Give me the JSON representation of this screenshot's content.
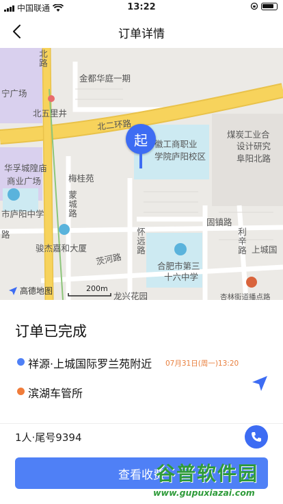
{
  "status_bar": {
    "carrier": "中国联通",
    "time": "13:22"
  },
  "nav": {
    "title": "订单详情"
  },
  "map": {
    "labels": {
      "jindu": "金都华庭一期",
      "ning_square": "宁广场",
      "north_road_v": "北路",
      "bei5lijing": "北五里井",
      "bei2huan": "北二环路",
      "coal": "煤炭工业合",
      "design": "设计研究",
      "fuyang_north": "阜阳北路",
      "hua": "华孚城隍庙",
      "commerce": "商业广场",
      "meigui": "梅桂苑",
      "meng_cheng": "蒙城路",
      "school": "市庐阳中学",
      "gu_zhen": "固镇路",
      "li_xin": "利辛路",
      "jun": "骏杰嘉和大厦",
      "chahe": "茨河路",
      "heliu": "合肥市第三",
      "no36": "十六中学",
      "shangcheng": "上城国",
      "huai_yuan": "怀远路",
      "long_xing": "龙兴花园",
      "xinglin": "杏林街道播点路",
      "vocational_1": "徽工商职业",
      "vocational_2": "学院庐阳校区",
      "road_lu": "路",
      "scale": "200m",
      "logo": "高德地图",
      "start_marker": "起"
    }
  },
  "order": {
    "status": "订单已完成",
    "pickup": "祥源·上城国际罗兰苑附近",
    "pickup_time": "07月31日(周一)13:20",
    "dropoff": "滨湖车管所",
    "passenger": "1人·尾号9394",
    "fare_button": "查看收费"
  },
  "watermark": {
    "title": "谷普软件园",
    "url": "www.gupuxiazai.com"
  },
  "colors": {
    "accent": "#4f80f6",
    "pickup_dot": "#4f80f6",
    "dropoff_dot": "#f07c3a",
    "road_yellow": "#f7d35c"
  }
}
